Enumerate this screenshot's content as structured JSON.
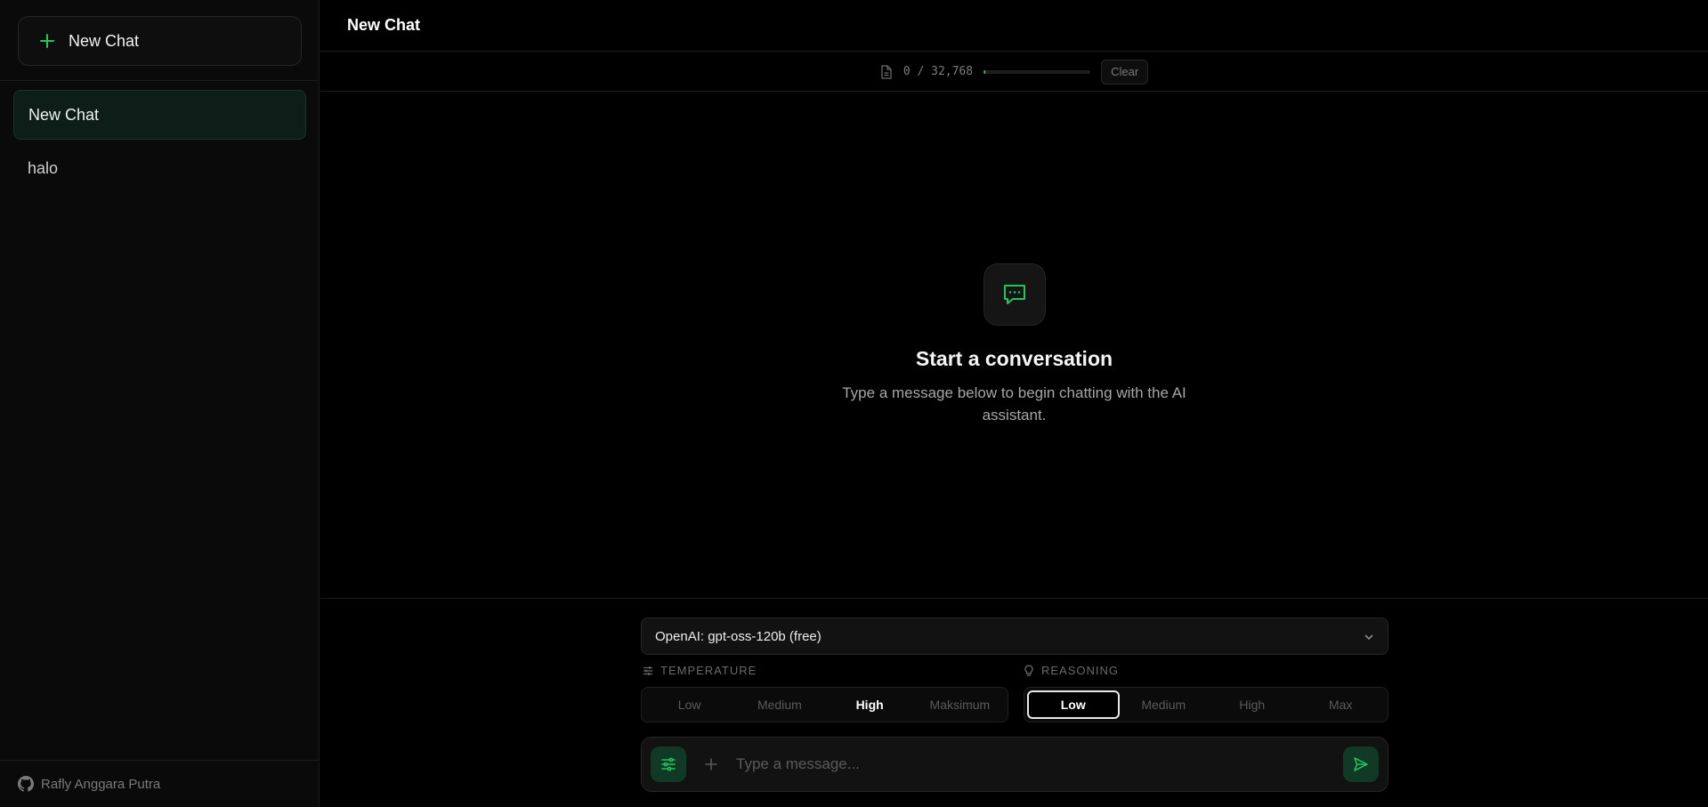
{
  "sidebar": {
    "new_chat_label": "New Chat",
    "items": [
      {
        "label": "New Chat",
        "active": true
      },
      {
        "label": "halo",
        "active": false
      }
    ],
    "footer": {
      "icon": "github-icon",
      "author": "Rafly Anggara Putra"
    }
  },
  "header": {
    "title": "New Chat"
  },
  "tokens": {
    "count": "0 / 32,768",
    "used_fraction": 0.01,
    "clear_label": "Clear"
  },
  "empty_state": {
    "icon": "chat-bubble-icon",
    "heading": "Start a conversation",
    "description": "Type a message below to begin chatting with the AI assistant."
  },
  "composer": {
    "model_selected": "OpenAI: gpt-oss-120b (free)",
    "temperature": {
      "label": "TEMPERATURE",
      "options": [
        "Low",
        "Medium",
        "High",
        "Maksimum"
      ],
      "selected": "High"
    },
    "reasoning": {
      "label": "REASONING",
      "options": [
        "Low",
        "Medium",
        "High",
        "Max"
      ],
      "selected": "Low"
    },
    "input_placeholder": "Type a message..."
  },
  "colors": {
    "accent": "#22c55e",
    "accent_dark": "#103a26",
    "background": "#000000",
    "sidebar": "#0a0a0a"
  }
}
